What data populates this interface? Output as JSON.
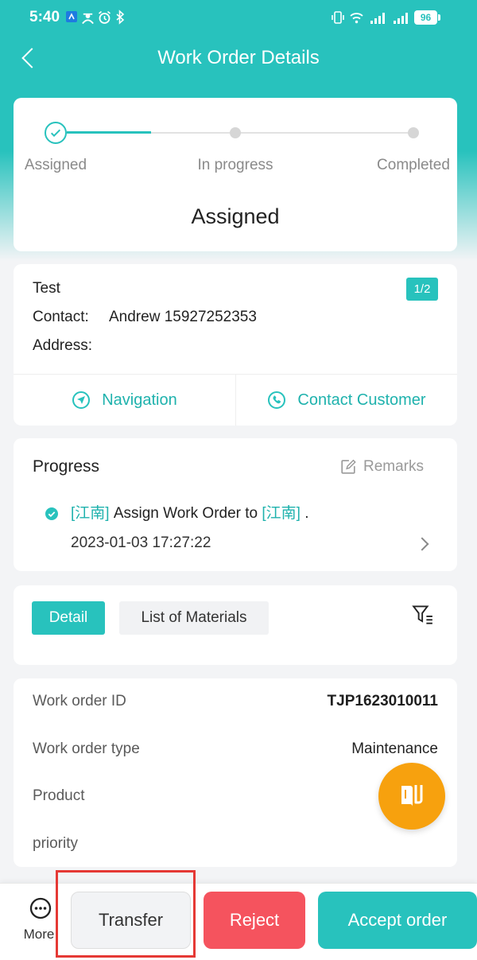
{
  "status_bar": {
    "time": "5:40",
    "battery_level": "96",
    "left_icons": [
      "app-notification-icon",
      "person-icon",
      "alarm-icon",
      "bluetooth-icon"
    ],
    "right_icons": [
      "vibrate-icon",
      "wifi-icon",
      "signal-icon",
      "signal-icon"
    ]
  },
  "header": {
    "title": "Work Order Details",
    "back_icon": "chevron-left-icon"
  },
  "status_stepper": {
    "steps": [
      {
        "label": "Assigned",
        "completed": true
      },
      {
        "label": "In progress",
        "completed": false
      },
      {
        "label": "Completed",
        "completed": false
      }
    ],
    "line_fill": 0.5,
    "current_status": "Assigned"
  },
  "customer": {
    "name": "Test",
    "page_badge": "1/2",
    "contact_label": "Contact:",
    "contact_value": "Andrew 15927252353",
    "address_label": "Address:",
    "address_value": "",
    "navigation_label": "Navigation",
    "navigation_icon": "navigation-icon",
    "contact_customer_label": "Contact Customer",
    "contact_customer_icon": "phone-icon"
  },
  "progress": {
    "title": "Progress",
    "remarks_label": "Remarks",
    "remarks_icon": "edit-icon",
    "entries": [
      {
        "actor": "[江南]",
        "action": "Assign Work Order to",
        "target": "[江南]",
        "end": ".",
        "timestamp": "2023-01-03 17:27:22"
      }
    ]
  },
  "tabs": [
    {
      "label": "Detail",
      "active": true
    },
    {
      "label": "List of Materials",
      "active": false
    }
  ],
  "filter_icon": "filter-icon",
  "details": [
    {
      "label": "Work order ID",
      "value": "TJP1623010011"
    },
    {
      "label": "Work order type",
      "value": "Maintenance"
    },
    {
      "label": "Product",
      "value": ""
    },
    {
      "label": "priority",
      "value": ""
    }
  ],
  "fab_icon": "book-icon",
  "bottom_bar": {
    "more_label": "More",
    "more_icon": "more-icon",
    "transfer_label": "Transfer",
    "reject_label": "Reject",
    "accept_label": "Accept order"
  },
  "colors": {
    "accent": "#28C2BD",
    "accent_text": "#1FB2AD",
    "reject": "#F5535E",
    "fab": "#F7A10E",
    "annotation": "#E53935"
  }
}
